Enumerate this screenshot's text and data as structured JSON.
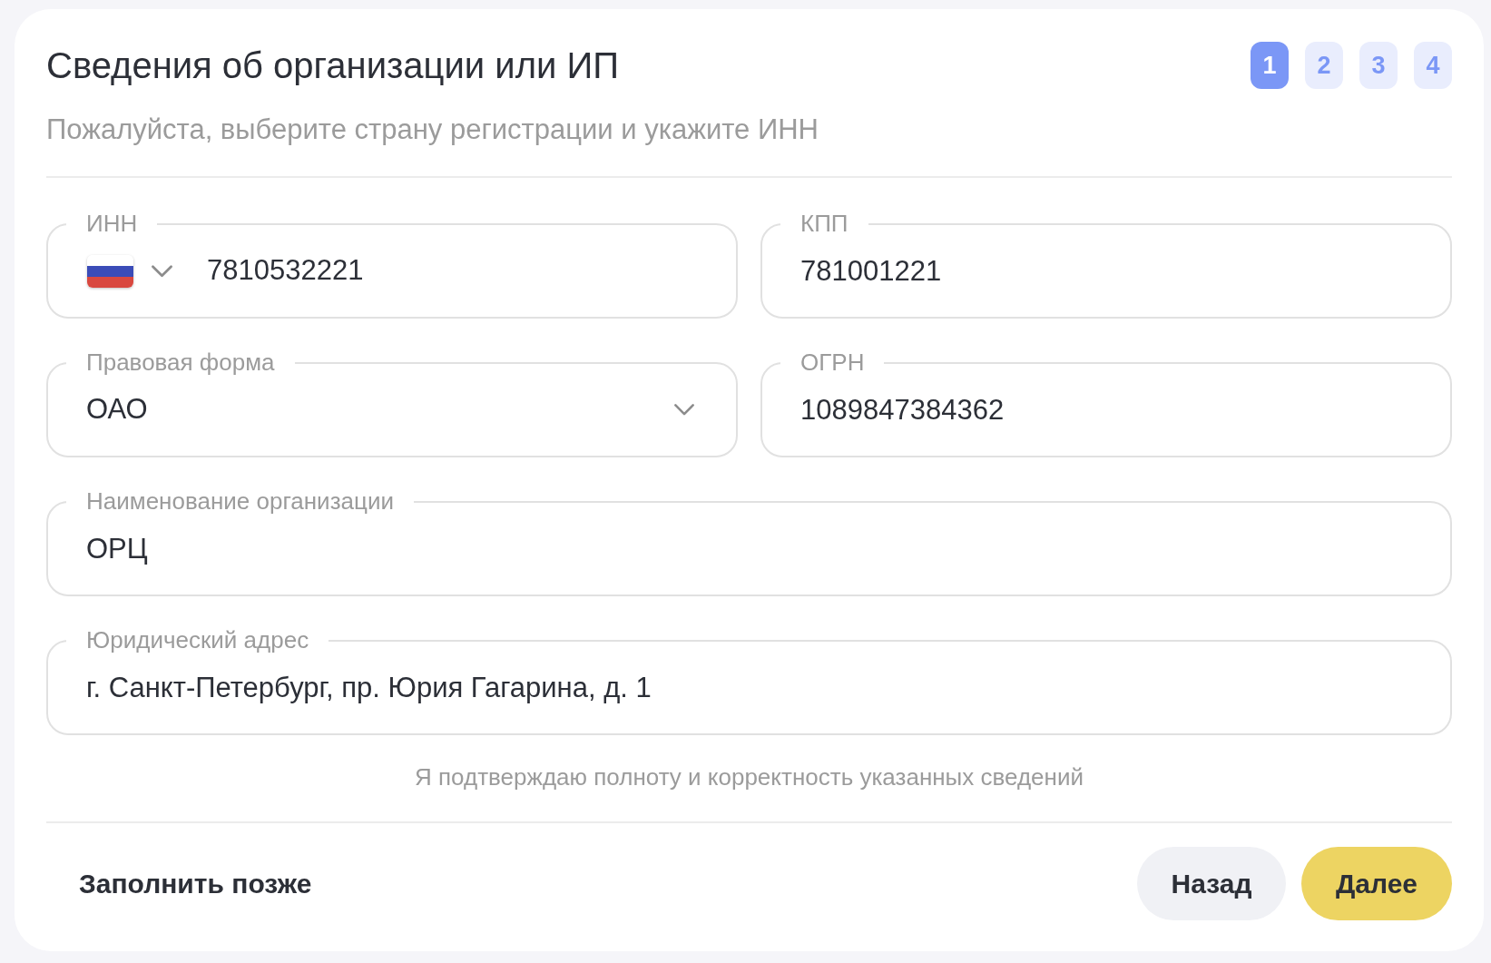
{
  "header": {
    "title": "Сведения об организации или ИП",
    "subtitle": "Пожалуйста, выберите страну регистрации и укажите ИНН",
    "steps": [
      {
        "label": "1",
        "selected": true
      },
      {
        "label": "2",
        "selected": false
      },
      {
        "label": "3",
        "selected": false
      },
      {
        "label": "4",
        "selected": false
      }
    ]
  },
  "form": {
    "rows": [
      [
        {
          "kind": "country_input",
          "label": "ИНН",
          "value": "7810532221"
        },
        {
          "kind": "input",
          "label": "КПП",
          "value": "781001221"
        }
      ],
      [
        {
          "kind": "select",
          "label": "Правовая форма",
          "value": "ОАО"
        },
        {
          "kind": "input",
          "label": "ОГРН",
          "value": "1089847384362"
        }
      ],
      [
        {
          "kind": "input",
          "label": "Наименование организации",
          "value": "ОРЦ"
        }
      ],
      [
        {
          "kind": "input",
          "label": "Юридический адрес",
          "value": "г. Санкт-Петербург, пр. Юрия Гагарина, д. 1"
        }
      ]
    ],
    "confirmation": "Я подтверждаю полноту и корректность указанных сведений"
  },
  "footer": {
    "later_link": "Заполнить позже",
    "buttons": [
      {
        "label": "Назад",
        "kind": "secondary"
      },
      {
        "label": "Далее",
        "kind": "primary"
      }
    ]
  }
}
